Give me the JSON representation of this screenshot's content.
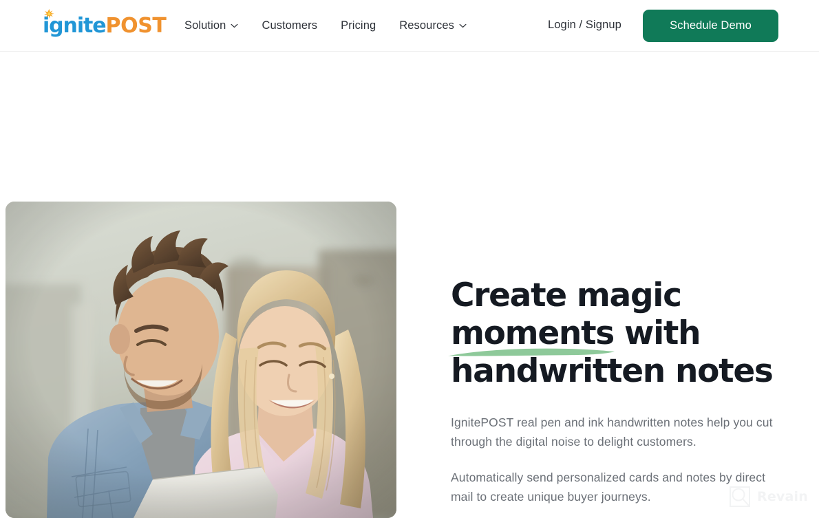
{
  "header": {
    "logo": {
      "name": "IgnitePOST",
      "part_blue": "ignite",
      "part_orange": "POST",
      "blue_hex": "#2196d6",
      "orange_hex": "#f0922f",
      "spark_icon": "sparkle-icon"
    },
    "nav_items": [
      {
        "label": "Solution",
        "has_dropdown": true,
        "icon": "chevron-down-icon"
      },
      {
        "label": "Customers",
        "has_dropdown": false,
        "icon": ""
      },
      {
        "label": "Pricing",
        "has_dropdown": false,
        "icon": ""
      },
      {
        "label": "Resources",
        "has_dropdown": true,
        "icon": "chevron-down-icon"
      }
    ],
    "login_label": "Login / Signup",
    "cta_label": "Schedule Demo",
    "cta_color": "#107a58"
  },
  "hero": {
    "title_line1": "Create magic",
    "title_highlight": "moments",
    "title_line2_rest": " with",
    "title_line3": "handwritten notes",
    "title_color": "#151a22",
    "highlight_stroke_color": "#8ec99a",
    "paragraph1": "IgnitePOST real pen and ink handwritten notes help you cut through the digital noise to delight customers.",
    "paragraph2": "Automatically send personalized cards and notes by direct mail to create unique buyer journeys.",
    "paragraph_color": "#6b7077",
    "image_alt": "Smiling couple reading a handwritten letter together"
  },
  "watermark": {
    "label": "Revain",
    "icon": "revain-logo-icon"
  }
}
